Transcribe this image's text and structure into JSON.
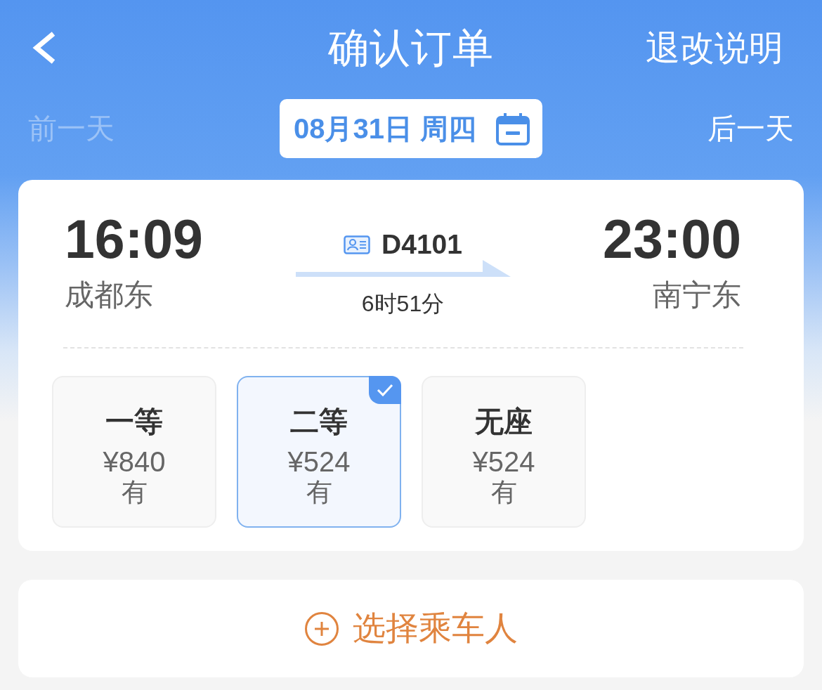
{
  "nav_bar": {
    "title": "确认订单",
    "action": "退改说明"
  },
  "date_bar": {
    "previous_day": {
      "label": "前一天",
      "disabled": true
    },
    "date": "08月31日 周四",
    "next_day": {
      "label": "后一天",
      "disabled": false
    }
  },
  "train": {
    "departure_time": "16:09",
    "departure_station": "成都东",
    "train_number": "D4101",
    "duration": "6时51分",
    "arrival_time": "23:00",
    "arrival_station": "南宁东"
  },
  "seats": [
    {
      "class": "一等",
      "price": "¥840",
      "availability": "有",
      "selected": false
    },
    {
      "class": "二等",
      "price": "¥524",
      "availability": "有",
      "selected": true
    },
    {
      "class": "无座",
      "price": "¥524",
      "availability": "有",
      "selected": false
    }
  ],
  "passenger_button": {
    "label": "选择乘车人"
  }
}
